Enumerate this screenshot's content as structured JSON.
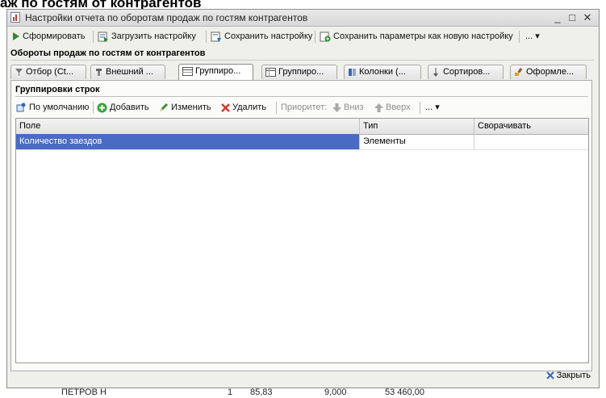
{
  "background": {
    "title": "аж по гостям от контрагентов",
    "bottom_row": [
      "ПЕТРОВ Н",
      "1",
      "85,83",
      "9,000",
      "53 460,00"
    ]
  },
  "window": {
    "title": "Настройки отчета по оборотам продаж по гостям контрагентов",
    "minimize": "_",
    "maximize": "□",
    "close": "✕"
  },
  "toolbar": {
    "generate": "Сформировать",
    "load": "Загрузить настройку",
    "save": "Сохранить настройку",
    "save_new": "Сохранить параметры как новую настройку",
    "more": "... ▾"
  },
  "section_title": "Обороты продаж по гостям от контрагентов",
  "tabs": [
    {
      "label": "Отбор (Ct..."
    },
    {
      "label": "Внешний ..."
    },
    {
      "label": "Группиро..."
    },
    {
      "label": "Группиро..."
    },
    {
      "label": "Колонки (..."
    },
    {
      "label": "Сортиров..."
    },
    {
      "label": "Оформле..."
    }
  ],
  "group": {
    "title": "Группировки строк",
    "toolbar": {
      "default": "По умолчанию",
      "add": "Добавить",
      "edit": "Изменить",
      "delete": "Удалить",
      "priority": "Приоритет:",
      "down": "Вниз",
      "up": "Вверх",
      "more": "... ▾"
    },
    "columns": [
      "Поле",
      "Тип",
      "Сворачивать"
    ],
    "rows": [
      {
        "field": "Количество заездов",
        "type": "Элементы",
        "collapse": ""
      }
    ]
  },
  "footer": {
    "close": "Закрыть"
  },
  "colors": {
    "selection": "#4a6bc4",
    "accent_green": "#2e8b2e",
    "delete_red": "#d03a2a"
  }
}
